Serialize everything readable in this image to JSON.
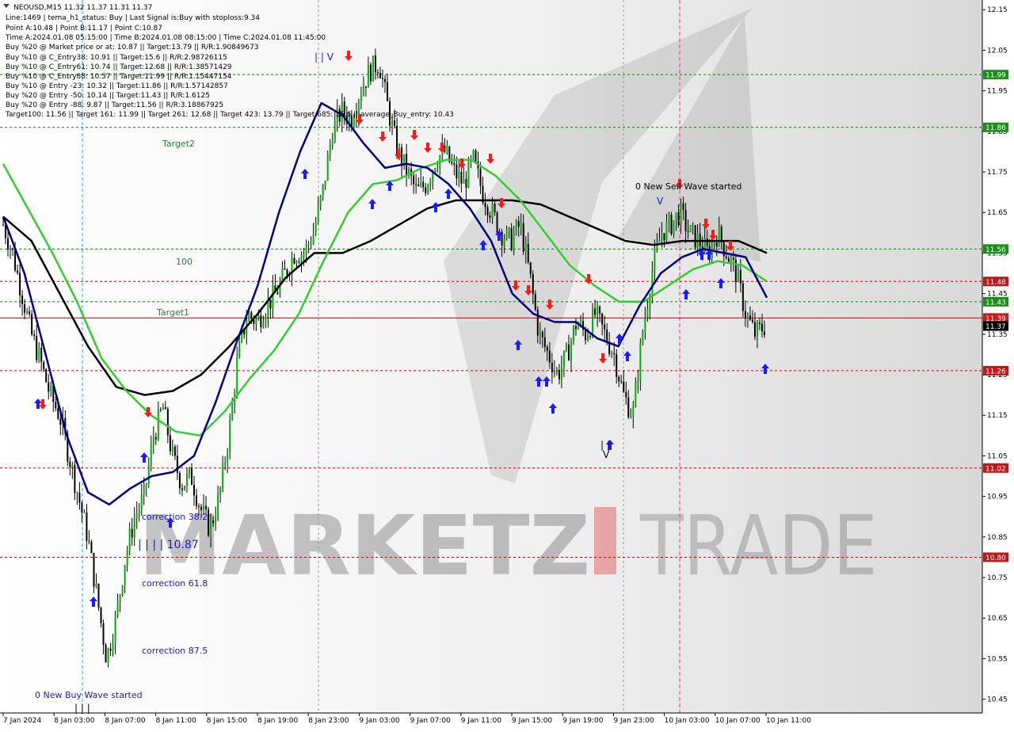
{
  "header": {
    "symbol_line": "NEOUSD,M15  11.32 11.37 11.31 11.37",
    "info_lines": [
      "Line:1469 | tema_h1_status: Buy | Last Signal is:Buy with stoploss:9.34",
      "Point A:10.48 | Point B:11.17 | Point C:10.87",
      "Time A:2024.01.08 05:15:00 | Time B:2024.01.08 08:15:00 | Time C:2024.01.08 11:45:00",
      "Buy %20 @ Market price or at: 10.87 || Target:13.79 || R/R:1.90849673",
      "Buy %10 @ C_Entry38: 10.91 || Target:15.6 || R/R:2.98726115",
      "Buy %10 @ C_Entry61: 10.74 || Target:12.68 || R/R:1.38571429",
      "Buy %10 @ C_Entry88: 10.57 || Target:11.99 || R/R:1.15447154",
      "Buy %10 @ Entry -23: 10.32 || Target:11.86 || R/R:1.57142857",
      "Buy %20 @ Entry -50: 10.14 || Target:11.43 || R/R:1.6125",
      "Buy %20 @ Entry -88: 9.87 || Target:11.56 || R/R:3.18867925",
      "Target100: 11.56 || Target 161: 11.99 || Target 261: 12.68 || Target 423: 13.79 || Target 685: 15.6 || average_Buy_entry: 10.43"
    ]
  },
  "annotations": {
    "target2": "Target2",
    "target1": "Target1",
    "level_100": "100",
    "sell_wave": "0 New Sell Wave started",
    "buy_wave": "0 New Buy Wave started",
    "corr_382": "correction 38.2",
    "corr_618": "correction 61.8",
    "corr_875": "correction 87.5",
    "point_c_label": "| | | | 10.87"
  },
  "watermark": {
    "text_left": "MARKETZ",
    "text_right": "TRADE"
  },
  "colors": {
    "green_line": "#008000",
    "red_line": "#c00000",
    "ma_fast": "#000080",
    "ma_mid": "#33cc33",
    "ma_slow": "#000000",
    "buy_arrow": "#1a1aff",
    "sell_arrow": "#ff1a1a",
    "current_price_bg": "#000000"
  },
  "chart_data": {
    "type": "candlestick",
    "symbol": "NEOUSD",
    "timeframe": "M15",
    "ylim": [
      10.42,
      12.17
    ],
    "y_ticks": [
      "12.15",
      "12.05",
      "11.95",
      "11.85",
      "11.75",
      "11.65",
      "11.55",
      "11.45",
      "11.35",
      "11.25",
      "11.15",
      "11.05",
      "10.95",
      "10.85",
      "10.75",
      "10.65",
      "10.55",
      "10.45"
    ],
    "x_ticks": [
      "7 Jan 2024",
      "8 Jan 03:00",
      "8 Jan 07:00",
      "8 Jan 11:00",
      "8 Jan 15:00",
      "8 Jan 19:00",
      "8 Jan 23:00",
      "9 Jan 03:00",
      "9 Jan 07:00",
      "9 Jan 11:00",
      "9 Jan 15:00",
      "9 Jan 19:00",
      "9 Jan 23:00",
      "10 Jan 03:00",
      "10 Jan 07:00",
      "10 Jan 11:00"
    ],
    "price_levels": [
      {
        "value": 11.99,
        "label": "11.99",
        "kind": "green"
      },
      {
        "value": 11.86,
        "label": "11.86",
        "kind": "green"
      },
      {
        "value": 11.56,
        "label": "11.56",
        "kind": "green"
      },
      {
        "value": 11.48,
        "label": "11.48",
        "kind": "red"
      },
      {
        "value": 11.43,
        "label": "11.43",
        "kind": "green"
      },
      {
        "value": 11.39,
        "label": "11.39",
        "kind": "red_solid"
      },
      {
        "value": 11.37,
        "label": "11.37",
        "kind": "current"
      },
      {
        "value": 11.26,
        "label": "11.26",
        "kind": "red"
      },
      {
        "value": 11.02,
        "label": "11.02",
        "kind": "red"
      },
      {
        "value": 10.8,
        "label": "10.80",
        "kind": "red"
      }
    ],
    "close_path": [
      11.62,
      11.55,
      11.45,
      11.35,
      11.28,
      11.2,
      11.15,
      11.05,
      10.95,
      10.85,
      10.7,
      10.55,
      10.65,
      10.8,
      10.9,
      10.95,
      11.1,
      11.17,
      11.05,
      10.98,
      11.0,
      10.92,
      10.87,
      10.95,
      11.1,
      11.3,
      11.4,
      11.38,
      11.42,
      11.45,
      11.5,
      11.55,
      11.55,
      11.6,
      11.7,
      11.85,
      11.9,
      11.88,
      11.95,
      12.0,
      12.02,
      11.9,
      11.8,
      11.75,
      11.7,
      11.72,
      11.78,
      11.8,
      11.75,
      11.72,
      11.78,
      11.7,
      11.65,
      11.6,
      11.58,
      11.62,
      11.5,
      11.35,
      11.3,
      11.25,
      11.3,
      11.38,
      11.35,
      11.4,
      11.35,
      11.3,
      11.2,
      11.15,
      11.35,
      11.5,
      11.6,
      11.62,
      11.65,
      11.6,
      11.58,
      11.55,
      11.6,
      11.55,
      11.5,
      11.4,
      11.35,
      11.37
    ],
    "ma_fast": [
      11.64,
      11.5,
      11.3,
      11.1,
      10.96,
      10.93,
      10.97,
      11.0,
      11.01,
      11.05,
      11.18,
      11.33,
      11.47,
      11.65,
      11.8,
      11.92,
      11.89,
      11.82,
      11.76,
      11.77,
      11.76,
      11.72,
      11.66,
      11.58,
      11.45,
      11.4,
      11.38,
      11.38,
      11.34,
      11.32,
      11.42,
      11.5,
      11.54,
      11.56,
      11.55,
      11.54,
      11.44
    ],
    "ma_mid": [
      11.77,
      11.66,
      11.55,
      11.43,
      11.29,
      11.21,
      11.15,
      11.11,
      11.1,
      11.16,
      11.24,
      11.31,
      11.4,
      11.53,
      11.65,
      11.72,
      11.73,
      11.76,
      11.78,
      11.78,
      11.74,
      11.68,
      11.6,
      11.52,
      11.47,
      11.43,
      11.43,
      11.47,
      11.51,
      11.53,
      11.52,
      11.48
    ],
    "ma_slow": [
      11.64,
      11.58,
      11.45,
      11.32,
      11.22,
      11.2,
      11.21,
      11.25,
      11.32,
      11.4,
      11.49,
      11.55,
      11.55,
      11.58,
      11.62,
      11.66,
      11.68,
      11.68,
      11.68,
      11.67,
      11.64,
      11.61,
      11.58,
      11.57,
      11.58,
      11.58,
      11.58,
      11.55
    ]
  }
}
